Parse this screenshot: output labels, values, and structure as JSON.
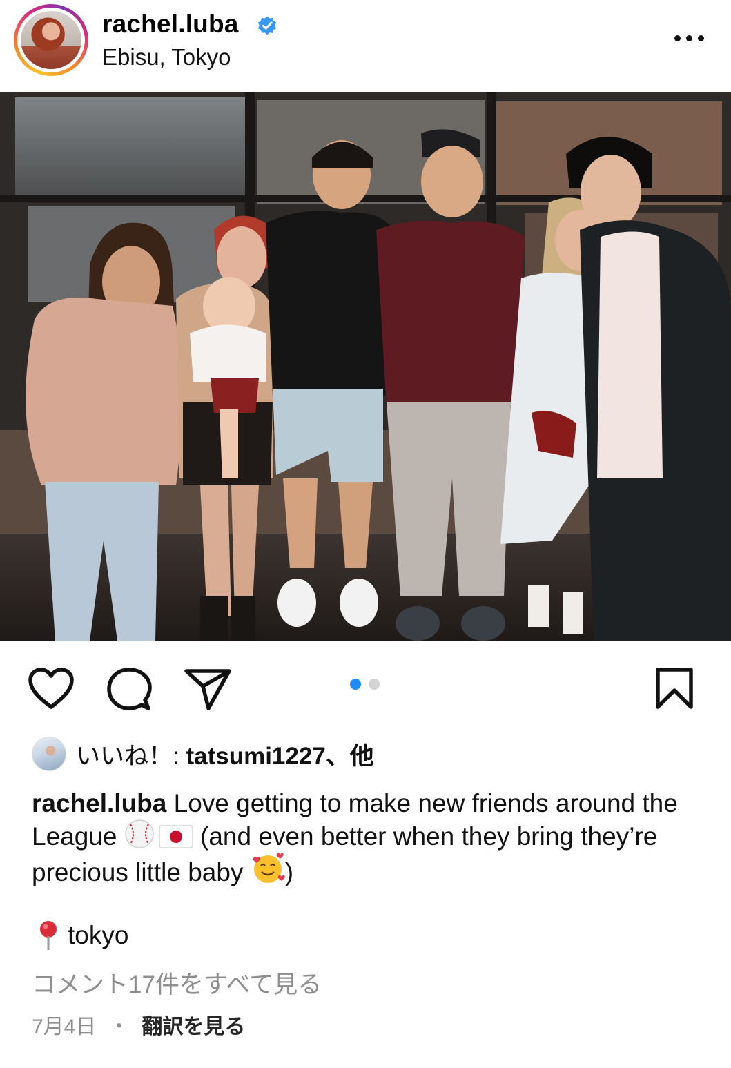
{
  "post": {
    "username": "rachel.luba",
    "verified": true,
    "location": "Ebisu, Tokyo",
    "more_icon": "ellipsis-icon"
  },
  "photo": {
    "carousel_count": 2,
    "active_index": 0
  },
  "actions": {
    "like_icon": "heart-icon",
    "comment_icon": "comment-bubble-icon",
    "share_icon": "paper-plane-icon",
    "save_icon": "bookmark-icon"
  },
  "likes": {
    "prefix": "いいね！: ",
    "user": "tatsumi1227",
    "suffix": "、他"
  },
  "caption": {
    "user": "rachel.luba",
    "text_1": " Love getting to make new friends around the League ",
    "text_2": " (and even better when they bring they’re precious little baby ",
    "text_3": ")"
  },
  "location_tag": {
    "icon": "round-pushpin-icon",
    "text": "tokyo"
  },
  "comments_link": "コメント17件をすべて見る",
  "footer": {
    "date": "7月4日",
    "separator": "・",
    "translate": "翻訳を見る"
  },
  "colors": {
    "accent_blue": "#1d8cf8",
    "muted_text": "#8e8e8e",
    "verified_blue": "#3897f0"
  }
}
